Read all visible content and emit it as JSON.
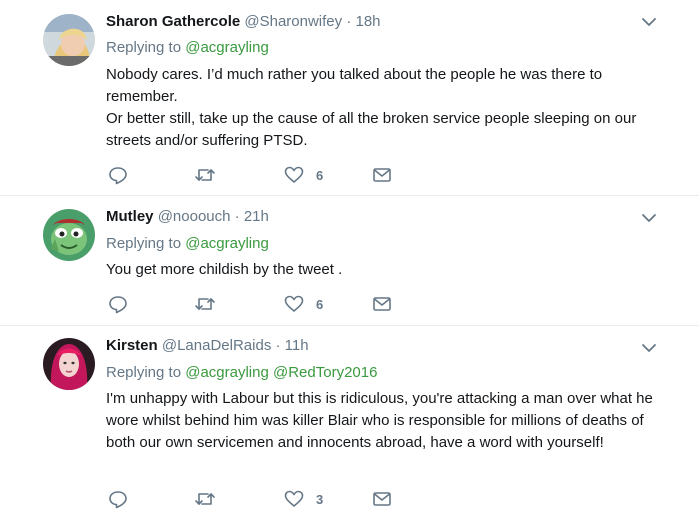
{
  "tweets": [
    {
      "name": "Sharon Gathercole",
      "handle": "@Sharonwifey",
      "separator": "·",
      "time": "18h",
      "replying_prefix": "Replying to",
      "replying_to": "@acgrayling",
      "replying_to_2": "",
      "text": [
        "Nobody cares. I’d much rather you talked about the people he was there to remember.",
        "Or better still, take up the cause of all the broken service people sleeping on our streets and/or suffering PTSD."
      ],
      "likes": "6",
      "avatar": "woman-blonde-avatar"
    },
    {
      "name": "Mutley",
      "handle": "@nooouch",
      "separator": "·",
      "time": "21h",
      "replying_prefix": "Replying to",
      "replying_to": "@acgrayling",
      "replying_to_2": "",
      "text": [
        "You get more childish by the tweet ."
      ],
      "likes": "6",
      "avatar": "green-cartoon-dog-avatar"
    },
    {
      "name": "Kirsten",
      "handle": "@LanaDelRaids",
      "separator": "·",
      "time": "11h",
      "replying_prefix": "Replying to",
      "replying_to": "@acgrayling",
      "replying_to_2": "@RedTory2016",
      "text": [
        "I'm unhappy with Labour but this is ridiculous, you're attacking a man over what he wore whilst behind him was killer Blair who is responsible for millions of deaths of both our own servicemen and innocents abroad, have a word with yourself!"
      ],
      "likes": "3",
      "avatar": "woman-pink-hair-avatar"
    }
  ],
  "colors": {
    "mention": "#3a9a3f",
    "muted": "#657786",
    "text": "#14171a",
    "divider": "#e6ecf0"
  },
  "icons": [
    "reply-icon",
    "retweet-icon",
    "heart-icon",
    "direct-message-icon",
    "caret-down-icon"
  ]
}
